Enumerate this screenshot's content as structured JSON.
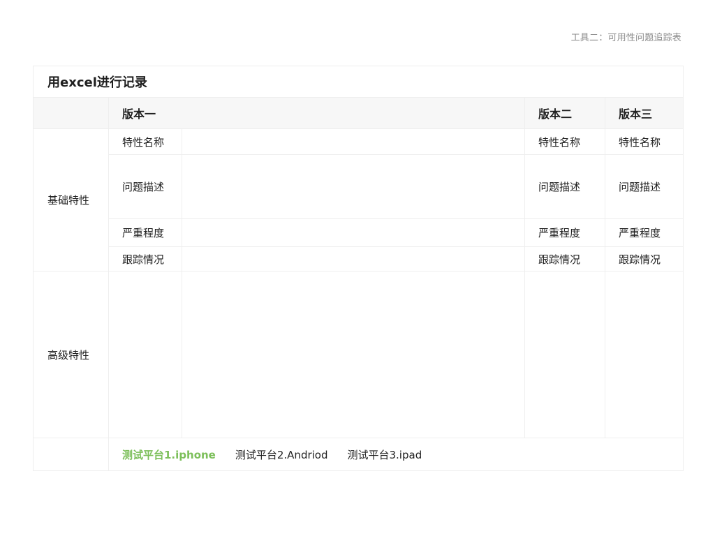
{
  "doc_title": "工具二：可用性问题追踪表",
  "sheet": {
    "title": "用excel进行记录",
    "versions": [
      "版本一",
      "版本二",
      "版本三"
    ],
    "basic_group": "基础特性",
    "advanced_group": "高级特性",
    "fields": {
      "feature_name": "特性名称",
      "issue_desc": "问题描述",
      "severity": "严重程度",
      "tracking": "跟踪情况"
    }
  },
  "platforms": {
    "tabs": [
      {
        "label": "测试平台1.iphone",
        "active": true
      },
      {
        "label": "测试平台2.Andriod",
        "active": false
      },
      {
        "label": "测试平台3.ipad",
        "active": false
      }
    ],
    "active_color": "#7cbf5a"
  }
}
